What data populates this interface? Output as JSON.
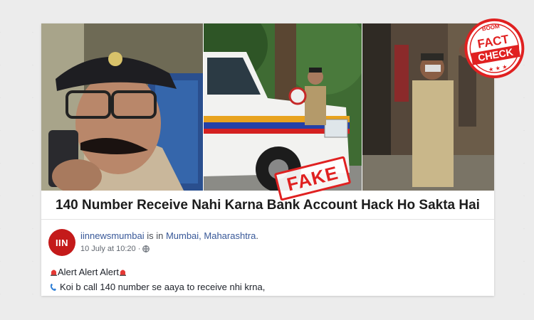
{
  "headline": "140 Number Receive Nahi Karna Bank Account Hack Ho Sakta Hai",
  "stamp": {
    "fake_label": "FAKE"
  },
  "badge": {
    "top": "BOOM",
    "line1": "FACT",
    "line2": "CHECK"
  },
  "post": {
    "avatar_text": "IIN",
    "avatar_subtext": "NEWS",
    "author": "iinnewsmumbai",
    "is_in": " is in ",
    "location": "Mumbai, Maharashtra",
    "location_end": ".",
    "timestamp": "10 July at 10:20 ·",
    "line1": " Alert Alert Alert ",
    "line2": "Koi b call 140 number se aaya to receive nhi krna,"
  },
  "colors": {
    "fake_red": "#e02121",
    "avatar_red": "#c41a1a",
    "link_blue": "#385898"
  }
}
